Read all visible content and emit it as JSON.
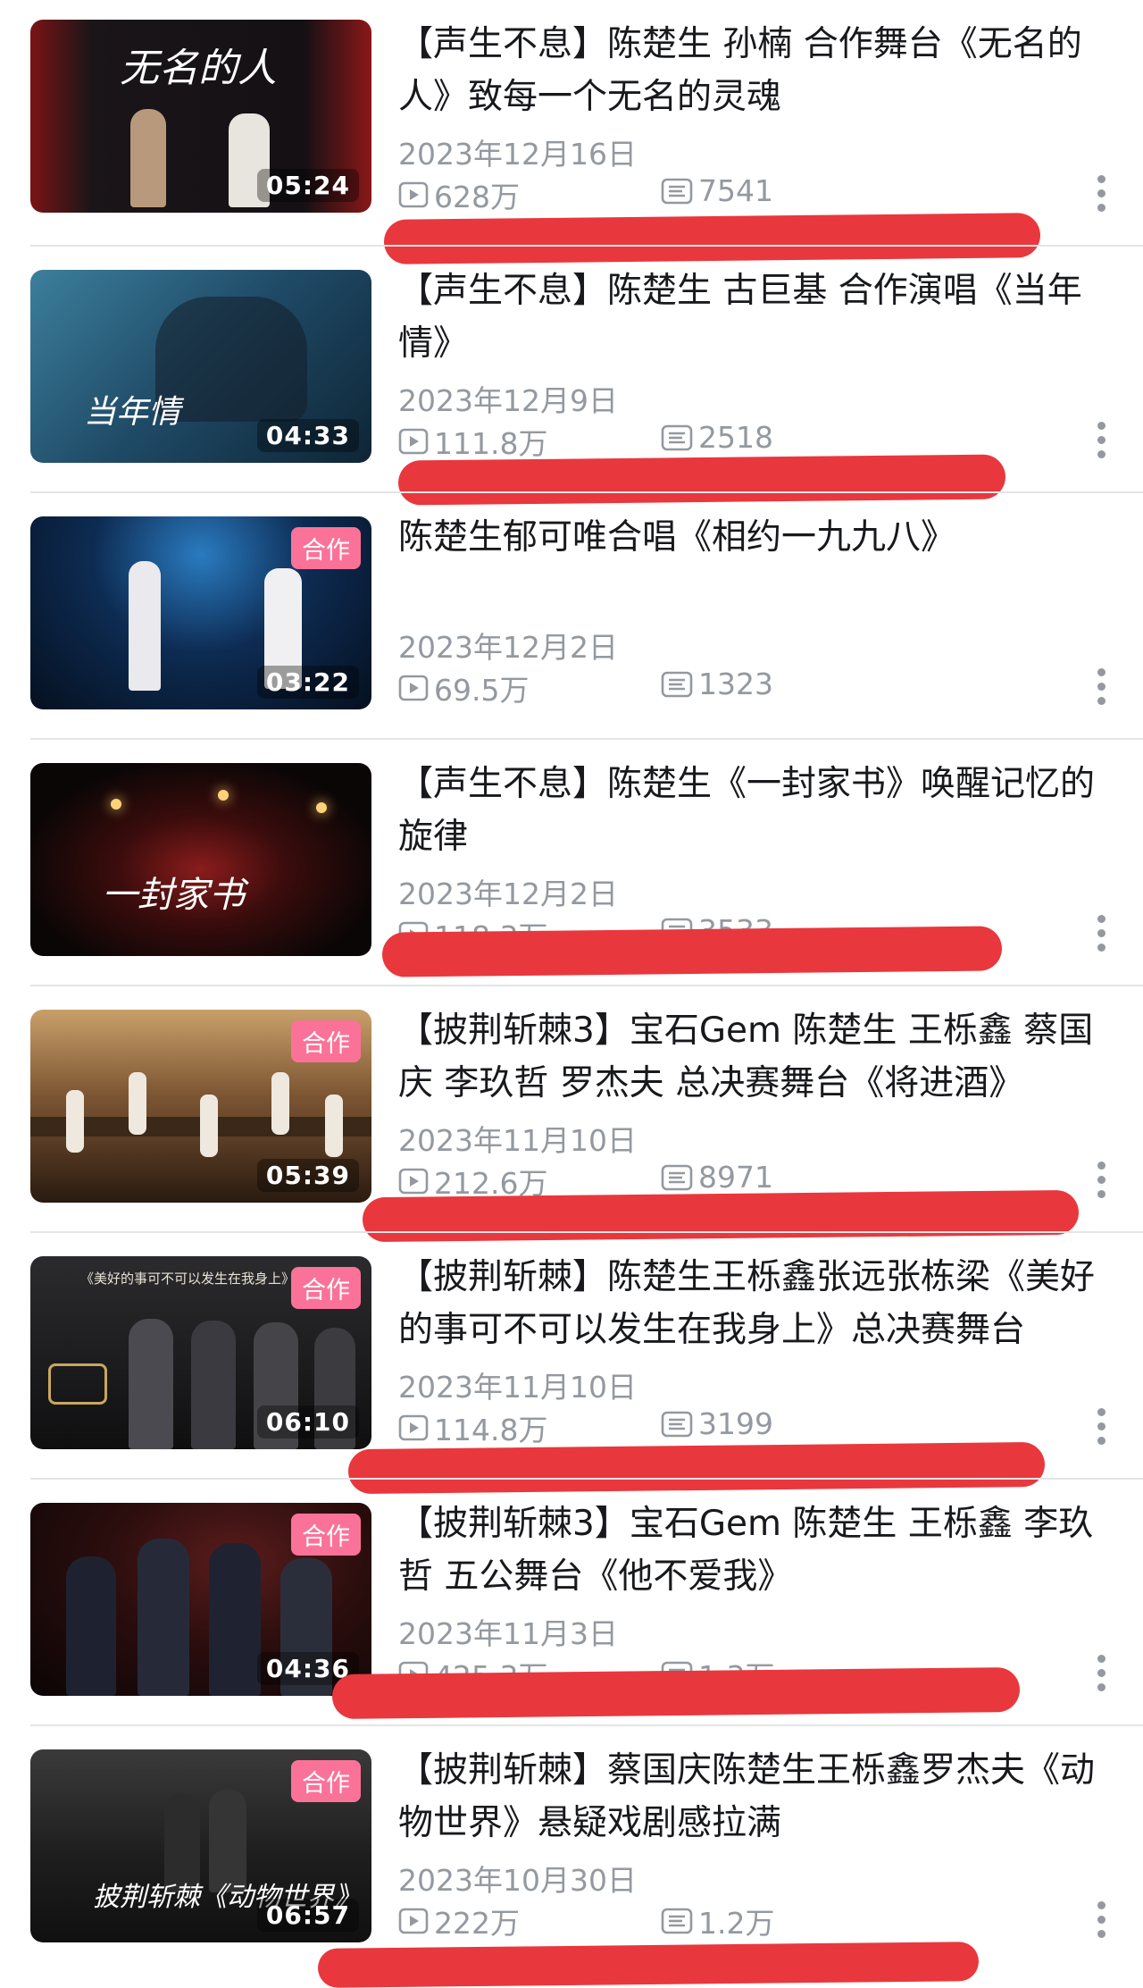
{
  "videos": [
    {
      "title": "【声生不息】陈楚生 孙楠 合作舞台《无名的人》致每一个无名的灵魂",
      "date": "2023年12月16日",
      "views": "628万",
      "danmaku": "7541",
      "duration": "05:24",
      "badge": "",
      "thumb_text": "无名的人"
    },
    {
      "title": "【声生不息】陈楚生 古巨基 合作演唱《当年情》",
      "date": "2023年12月9日",
      "views": "111.8万",
      "danmaku": "2518",
      "duration": "04:33",
      "badge": "",
      "thumb_text": "当年情"
    },
    {
      "title": "陈楚生郁可唯合唱《相约一九九八》",
      "date": "2023年12月2日",
      "views": "69.5万",
      "danmaku": "1323",
      "duration": "03:22",
      "badge": "合作",
      "thumb_text": ""
    },
    {
      "title": "【声生不息】陈楚生《一封家书》唤醒记忆的旋律",
      "date": "2023年12月2日",
      "views": "118.3万",
      "danmaku": "3533",
      "duration": "",
      "badge": "",
      "thumb_text": "一封家书"
    },
    {
      "title": "【披荆斩棘3】宝石Gem 陈楚生 王栎鑫 蔡国庆 李玖哲 罗杰夫 总决赛舞台《将进酒》",
      "date": "2023年11月10日",
      "views": "212.6万",
      "danmaku": "8971",
      "duration": "05:39",
      "badge": "合作",
      "thumb_text": ""
    },
    {
      "title": "【披荆斩棘】陈楚生王栎鑫张远张栋梁《美好的事可不可以发生在我身上》总决赛舞台",
      "date": "2023年11月10日",
      "views": "114.8万",
      "danmaku": "3199",
      "duration": "06:10",
      "badge": "合作",
      "thumb_text": "《美好的事可不可以发生在我身上》"
    },
    {
      "title": "【披荆斩棘3】宝石Gem 陈楚生 王栎鑫 李玖哲 五公舞台《他不爱我》",
      "date": "2023年11月3日",
      "views": "425.3万",
      "danmaku": "1.3万",
      "duration": "04:36",
      "badge": "合作",
      "thumb_text": ""
    },
    {
      "title": "【披荆斩棘】蔡国庆陈楚生王栎鑫罗杰夫《动物世界》悬疑戏剧感拉满",
      "date": "2023年10月30日",
      "views": "222万",
      "danmaku": "1.2万",
      "duration": "06:57",
      "badge": "合作",
      "thumb_text": "披荆斩棘《动物世界》"
    }
  ],
  "colors": {
    "badge": "#fb7299",
    "meta_text": "#9499a0",
    "title_text": "#18191c",
    "red_annotation": "#e8383d"
  }
}
